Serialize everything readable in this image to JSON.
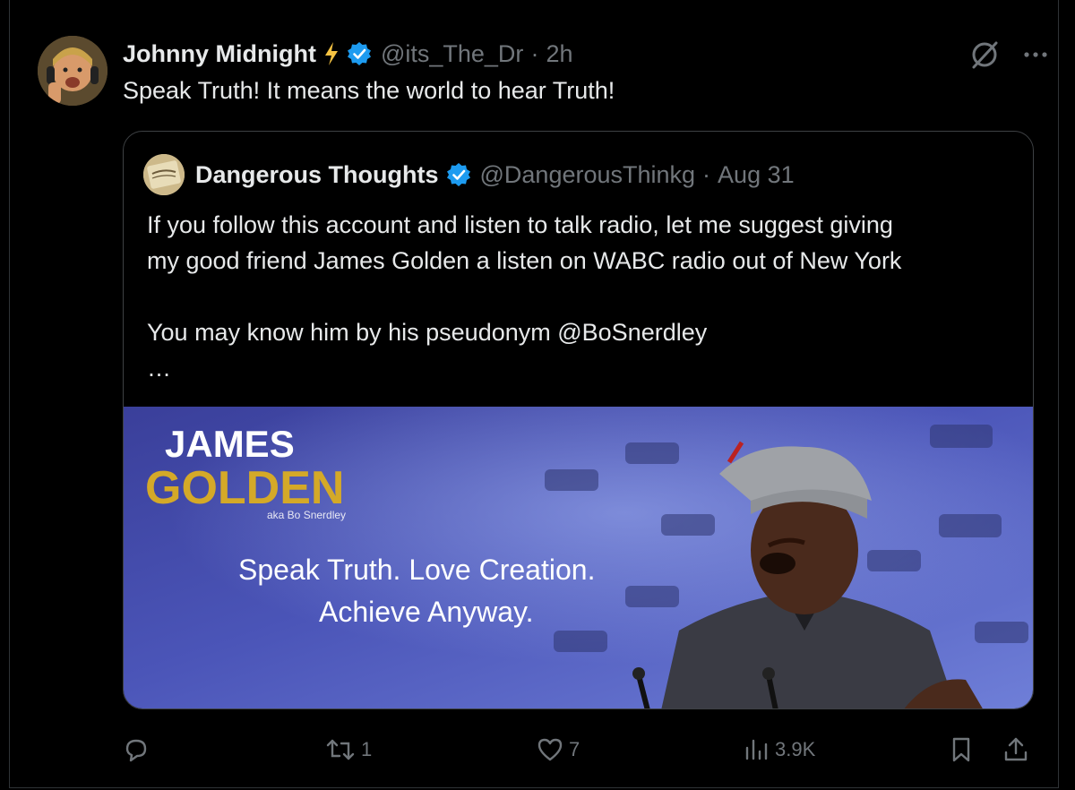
{
  "tweet": {
    "author": {
      "display_name": "Johnny Midnight",
      "handle": "@its_The_Dr",
      "time": "2h",
      "separator": "·",
      "avatar_icon": "profile-photo"
    },
    "text": "Speak Truth! It means the world to hear Truth!",
    "icons": {
      "badge": "lightning-bolt-icon",
      "verified": "verified-badge-icon",
      "grok": "grok-icon",
      "more": "more-options-icon"
    }
  },
  "quote": {
    "author": {
      "display_name": "Dangerous Thoughts",
      "handle": "@DangerousThinkg",
      "time": "Aug 31",
      "separator": "·"
    },
    "text_line1": "If you follow this account and listen to talk radio, let me suggest giving",
    "text_line2": "my good friend James Golden a listen on WABC radio out of New York",
    "text_line3": "You may know him by his pseudonym @BoSnerdley",
    "ellipsis": "…",
    "media": {
      "title_line1": "JAMES",
      "title_line2": "GOLDEN",
      "aka": "aka Bo Snerdley",
      "tagline_line1": "Speak Truth.  Love Creation.",
      "tagline_line2": "Achieve Anyway."
    }
  },
  "actions": {
    "reply": {
      "icon": "reply-icon",
      "count": ""
    },
    "retweet": {
      "icon": "retweet-icon",
      "count": "1"
    },
    "like": {
      "icon": "heart-icon",
      "count": "7"
    },
    "views": {
      "icon": "views-icon",
      "count": "3.9K"
    },
    "bookmark": {
      "icon": "bookmark-icon"
    },
    "share": {
      "icon": "share-icon"
    }
  },
  "colors": {
    "background": "#000000",
    "text_primary": "#e7e9ea",
    "text_secondary": "#71767b",
    "verified_blue": "#1d9bf0",
    "bolt_yellow": "#f6c342",
    "gold": "#d4a928"
  }
}
